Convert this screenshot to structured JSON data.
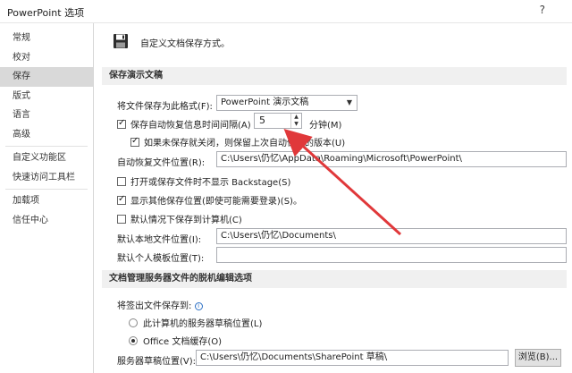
{
  "window": {
    "title": "PowerPoint 选项",
    "help": "?"
  },
  "sidebar": {
    "items": [
      {
        "label": "常规"
      },
      {
        "label": "校对"
      },
      {
        "label": "保存",
        "active": true
      },
      {
        "label": "版式"
      },
      {
        "label": "语言"
      },
      {
        "label": "高级"
      },
      {
        "label": "自定义功能区"
      },
      {
        "label": "快速访问工具栏"
      },
      {
        "label": "加载项"
      },
      {
        "label": "信任中心"
      }
    ]
  },
  "main": {
    "header_text": "自定义文档保存方式。",
    "section_save": "保存演示文稿",
    "format_label": "将文件保存为此格式(F):",
    "format_value": "PowerPoint 演示文稿",
    "autorecover_label": "保存自动恢复信息时间间隔(A)",
    "autorecover_checked": true,
    "autorecover_minutes": "5",
    "minutes_label": "分钟(M)",
    "keep_last_label": "如果未保存就关闭，则保留上次自动保存的版本(U)",
    "keep_last_checked": true,
    "autorecover_path_label": "自动恢复文件位置(R):",
    "autorecover_path": "C:\\Users\\仍忆\\AppData\\Roaming\\Microsoft\\PowerPoint\\",
    "no_backstage_label": "打开或保存文件时不显示 Backstage(S)",
    "no_backstage_checked": false,
    "show_other_label": "显示其他保存位置(即使可能需要登录)(S)。",
    "show_other_checked": true,
    "default_computer_label": "默认情况下保存到计算机(C)",
    "default_computer_checked": false,
    "default_local_label": "默认本地文件位置(I):",
    "default_local_value": "C:\\Users\\仍忆\\Documents\\",
    "default_template_label": "默认个人模板位置(T):",
    "default_template_value": "",
    "section_offline": "文档管理服务器文件的脱机编辑选项",
    "checkout_label": "将签出文件保存到:",
    "radio_server_label": "此计算机的服务器草稿位置(L)",
    "radio_office_label": "Office 文档缓存(O)",
    "server_drafts_label": "服务器草稿位置(V):",
    "server_drafts_value": "C:\\Users\\仍忆\\Documents\\SharePoint 草稿\\",
    "browse_label": "浏览(B)..."
  },
  "colors": {
    "annotation_arrow": "#e0383a",
    "sidebar_active": "#d9d9d9",
    "section_bg": "#f0f0f0"
  }
}
